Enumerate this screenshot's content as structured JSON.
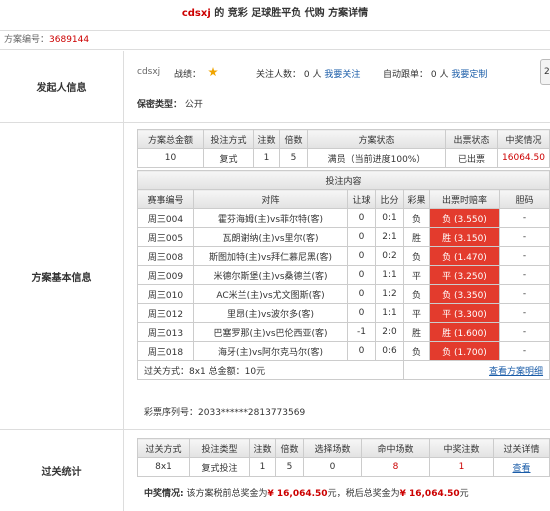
{
  "header": {
    "user": "cdsxj",
    "title_mid": "的 竞彩 足球胜平负 代购",
    "title_end": "方案详情"
  },
  "plan_id": {
    "label": "方案编号：",
    "value": "3689144"
  },
  "initiator": {
    "section_label": "发起人信息",
    "username": "cdsxj",
    "record_label": "战绩：",
    "followers_label": "关注人数：",
    "followers_value": "0 人",
    "follow_link": "我要关注",
    "auto_follow_label": "自动跟单：",
    "auto_follow_value": "0 人",
    "custom_link": "我要定制",
    "privacy_label": "保密类型：",
    "privacy_value": "公开",
    "side_button": "2"
  },
  "plan_info": {
    "section_label": "方案基本信息",
    "summary_headers": [
      "方案总金额",
      "投注方式",
      "注数",
      "倍数",
      "方案状态",
      "出票状态",
      "中奖情况"
    ],
    "summary_row": {
      "amount": "10",
      "method": "复式",
      "bets": "1",
      "multiple": "5",
      "status": "满员（当前进度100%）",
      "ticket_status": "已出票",
      "prize": "16064.50"
    },
    "content_header": "投注内容",
    "match_headers": [
      "赛事编号",
      "对阵",
      "让球",
      "比分",
      "彩果",
      "出票时赔率",
      "胆码"
    ],
    "matches": [
      {
        "id": "周三004",
        "fixture": "霍芬海姆(主)vs菲尔特(客)",
        "handicap": "0",
        "score": "0:1",
        "result": "负",
        "odds": "负 (3.550)",
        "banker": "-"
      },
      {
        "id": "周三005",
        "fixture": "瓦朗谢纳(主)vs里尔(客)",
        "handicap": "0",
        "score": "2:1",
        "result": "胜",
        "odds": "胜 (3.150)",
        "banker": "-"
      },
      {
        "id": "周三008",
        "fixture": "斯图加特(主)vs拜仁慕尼黑(客)",
        "handicap": "0",
        "score": "0:2",
        "result": "负",
        "odds": "负 (1.470)",
        "banker": "-"
      },
      {
        "id": "周三009",
        "fixture": "米德尔斯堡(主)vs桑德兰(客)",
        "handicap": "0",
        "score": "1:1",
        "result": "平",
        "odds": "平 (3.250)",
        "banker": "-"
      },
      {
        "id": "周三010",
        "fixture": "AC米兰(主)vs尤文图斯(客)",
        "handicap": "0",
        "score": "1:2",
        "result": "负",
        "odds": "负 (3.350)",
        "banker": "-"
      },
      {
        "id": "周三012",
        "fixture": "里昂(主)vs波尔多(客)",
        "handicap": "0",
        "score": "1:1",
        "result": "平",
        "odds": "平 (3.300)",
        "banker": "-"
      },
      {
        "id": "周三013",
        "fixture": "巴塞罗那(主)vs巴伦西亚(客)",
        "handicap": "-1",
        "score": "2:0",
        "result": "胜",
        "odds": "胜 (1.600)",
        "banker": "-"
      },
      {
        "id": "周三018",
        "fixture": "海牙(主)vs阿尔克马尔(客)",
        "handicap": "0",
        "score": "0:6",
        "result": "负",
        "odds": "负 (1.700)",
        "banker": "-"
      }
    ],
    "footer_text": "过关方式：8x1 总金额：10元",
    "view_detail_link": "查看方案明细",
    "serial_label": "彩票序列号：",
    "serial_value": "2033******2813773569"
  },
  "pass_stats": {
    "section_label": "过关统计",
    "headers": [
      "过关方式",
      "投注类型",
      "注数",
      "倍数",
      "选择场数",
      "命中场数",
      "中奖注数",
      "过关详情"
    ],
    "row": {
      "pass": "8x1",
      "type": "复式投注",
      "bets": "1",
      "multiple": "5",
      "selected": "0",
      "hits": "8",
      "prize_bets": "1",
      "detail": "查看"
    },
    "prize_label": "中奖情况:",
    "prize_pre": "该方案税前总奖金为",
    "prize_pre_value": "¥ 16,064.50",
    "prize_mid": "元，税后总奖金为",
    "prize_post_value": "¥ 16,064.50",
    "prize_end": "元"
  },
  "colors": {
    "accent_red": "#c00",
    "odds_bg": "#e33b2d",
    "link": "#1a5ca8"
  }
}
